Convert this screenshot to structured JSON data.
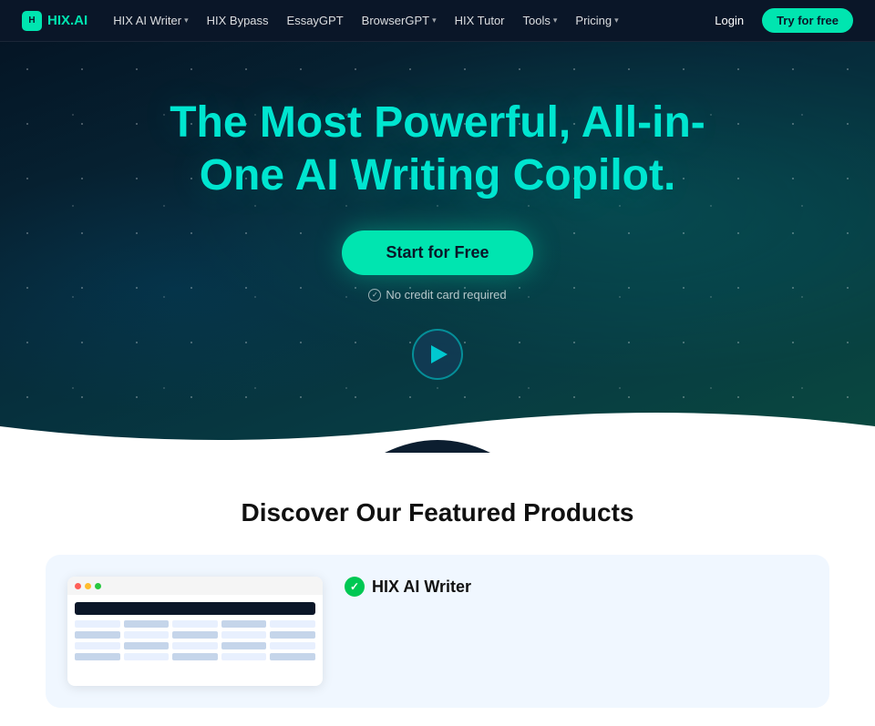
{
  "logo": {
    "icon": "H",
    "text_pre": "HIX",
    "text_accent": ".AI"
  },
  "nav": {
    "links": [
      {
        "label": "HIX AI Writer",
        "has_dropdown": true
      },
      {
        "label": "HIX Bypass",
        "has_dropdown": false
      },
      {
        "label": "EssayGPT",
        "has_dropdown": false
      },
      {
        "label": "BrowserGPT",
        "has_dropdown": true
      },
      {
        "label": "HIX Tutor",
        "has_dropdown": false
      },
      {
        "label": "Tools",
        "has_dropdown": true
      },
      {
        "label": "Pricing",
        "has_dropdown": true
      }
    ],
    "login": "Login",
    "try_free": "Try for free"
  },
  "hero": {
    "title_line1": "The Most Powerful, All-in-",
    "title_line2": "One AI Writing Copilot.",
    "cta_button": "Start for Free",
    "no_credit": "No credit card required",
    "play_label": "Watch demo"
  },
  "featured": {
    "title": "Discover Our Featured Products",
    "product_name": "HIX AI Writer"
  }
}
